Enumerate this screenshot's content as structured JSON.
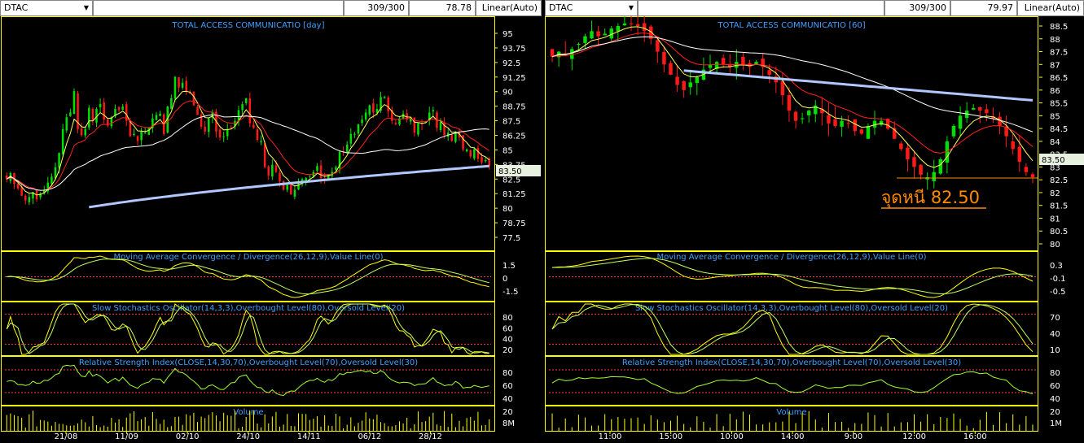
{
  "panels": [
    {
      "id": "left",
      "symbol": "DTAC",
      "count": "309/300",
      "last_price": "78.78",
      "scale": "Linear(Auto)",
      "price_title": "TOTAL ACCESS COMMUNICATIO [day]",
      "price_ticks": [
        "95",
        "93.75",
        "92.5",
        "91.25",
        "90",
        "88.75",
        "87.5",
        "86.25",
        "85",
        "83.75",
        "82.5",
        "81.25",
        "80",
        "78.75",
        "77.5"
      ],
      "price_tag": "83.50",
      "macd_title": "Moving Average Convergence / Divergence(26,12,9),Value Line(0)",
      "macd_ticks": [
        "1.5",
        "0",
        "-1.5"
      ],
      "stoch_title": "Slow Stochastics Oscillator(14,3,3),Overbought Level(80),Oversold Level(20)",
      "stoch_ticks": [
        "80",
        "60",
        "40",
        "20"
      ],
      "rsi_title": "Relative Strength Index(CLOSE,14,30,70),Overbought Level(70),Oversold Level(30)",
      "rsi_ticks": [
        "80",
        "60",
        "40",
        "20"
      ],
      "vol_title": "Volume",
      "vol_tick": "8M",
      "x_ticks": [
        "21/08",
        "11/09",
        "02/10",
        "24/10",
        "14/11",
        "06/12",
        "28/12"
      ]
    },
    {
      "id": "right",
      "symbol": "DTAC",
      "count": "309/300",
      "last_price": "79.97",
      "scale": "Linear(Auto)",
      "price_title": "TOTAL ACCESS COMMUNICATIO [60]",
      "price_ticks": [
        "88.5",
        "88",
        "87.5",
        "87",
        "86.5",
        "86",
        "85.5",
        "85",
        "84.5",
        "84",
        "83.5",
        "83",
        "82.5",
        "82",
        "81.5",
        "81",
        "80.5",
        "80"
      ],
      "price_tag": "83.50",
      "annotation": "จุดหนี 82.50",
      "macd_title": "Moving Average Convergence / Divergence(26,12,9),Value Line(0)",
      "macd_ticks": [
        "0.3",
        "-0.1",
        "-0.5"
      ],
      "stoch_title": "Slow Stochastics Oscillator(14,3,3),Overbought Level(80),Oversold Level(20)",
      "stoch_ticks": [
        "70",
        "40",
        "10"
      ],
      "rsi_title": "Relative Strength Index(CLOSE,14,30,70),Overbought Level(70),Oversold Level(30)",
      "rsi_ticks": [
        "80",
        "60",
        "40",
        "20"
      ],
      "vol_title": "Volume",
      "vol_tick": "1M",
      "x_ticks": [
        "11:00",
        "15:00",
        "10:00",
        "14:00",
        "9:00",
        "12:00",
        "16:00"
      ]
    }
  ],
  "chart_data": [
    {
      "type": "candlestick",
      "title": "TOTAL ACCESS COMMUNICATIO [day]",
      "x_ticks": [
        "21/08",
        "11/09",
        "02/10",
        "24/10",
        "14/11",
        "06/12",
        "28/12"
      ],
      "ylim": [
        77.5,
        95
      ],
      "close_series": [
        82.4,
        82.9,
        82.0,
        81.6,
        81.0,
        80.6,
        80.9,
        81.3,
        80.7,
        81.2,
        81.5,
        82.1,
        82.6,
        83.4,
        84.6,
        86.6,
        87.6,
        88.0,
        89.8,
        86.6,
        86.1,
        86.6,
        88.4,
        87.3,
        88.3,
        88.7,
        87.4,
        86.9,
        87.6,
        88.3,
        88.2,
        88.5,
        87.3,
        86.0,
        86.2,
        85.6,
        86.4,
        86.3,
        86.7,
        87.5,
        87.8,
        87.9,
        86.2,
        88.5,
        89.2,
        91.0,
        90.1,
        90.5,
        89.8,
        89.6,
        88.6,
        87.8,
        86.8,
        86.4,
        87.5,
        88.0,
        86.4,
        85.9,
        86.0,
        86.6,
        86.7,
        87.3,
        88.2,
        88.7,
        89.2,
        87.1,
        86.7,
        85.7,
        85.6,
        83.4,
        82.7,
        83.6,
        83.0,
        82.2,
        81.5,
        81.9,
        81.1,
        81.5,
        82.0,
        82.4,
        82.5,
        82.7,
        83.0,
        83.5,
        82.5,
        82.4,
        82.8,
        83.0,
        83.4,
        84.7,
        84.7,
        85.3,
        86.2,
        86.2,
        87.0,
        87.4,
        88.0,
        88.6,
        88.0,
        88.3,
        89.3,
        89.3,
        88.1,
        87.3,
        87.0,
        87.5,
        87.9,
        87.4,
        87.6,
        86.3,
        87.1,
        87.0,
        87.2,
        88.0,
        88.2,
        86.7,
        87.2,
        86.1,
        86.3,
        85.6,
        86.4,
        85.9,
        84.9,
        84.9,
        84.3,
        84.9,
        84.1,
        83.8,
        84.0,
        83.5
      ],
      "moving_averages": [
        "close-ma",
        "short-ma",
        "medium-ma",
        "long-ma"
      ],
      "indicators": [
        "MACD(26,12,9)",
        "Slow Stochastics(14,3,3)",
        "RSI(14,30,70)",
        "Volume"
      ],
      "macd_ylim": [
        -1.5,
        1.5
      ],
      "stoch_levels": [
        80,
        20
      ],
      "rsi_levels": [
        70,
        30
      ]
    },
    {
      "type": "candlestick",
      "title": "TOTAL ACCESS COMMUNICATIO [60]",
      "x_ticks": [
        "11:00",
        "15:00",
        "10:00",
        "14:00",
        "9:00",
        "12:00",
        "16:00"
      ],
      "ylim": [
        80,
        88.5
      ],
      "close_series": [
        87.3,
        87.5,
        87.4,
        87.6,
        87.8,
        88.1,
        88.3,
        88.1,
        88.2,
        88.4,
        88.5,
        88.6,
        88.6,
        88.5,
        88.3,
        88.0,
        87.5,
        87.0,
        86.6,
        86.2,
        86.0,
        86.3,
        86.5,
        86.8,
        87.0,
        87.1,
        87.0,
        86.9,
        87.1,
        87.0,
        86.9,
        87.1,
        86.9,
        86.6,
        86.3,
        85.8,
        85.2,
        84.8,
        84.9,
        85.2,
        85.4,
        85.1,
        84.7,
        84.6,
        84.8,
        84.7,
        84.4,
        84.3,
        84.6,
        84.8,
        84.8,
        84.5,
        84.1,
        83.7,
        83.3,
        83.0,
        82.7,
        82.6,
        82.8,
        83.3,
        84.0,
        84.6,
        85.0,
        85.2,
        85.3,
        85.2,
        85.1,
        84.9,
        84.6,
        84.2,
        83.7,
        83.2,
        82.8,
        82.6
      ],
      "moving_averages": [
        "close-ma",
        "short-ma",
        "medium-ma",
        "long-ma"
      ],
      "indicators": [
        "MACD(26,12,9)",
        "Slow Stochastics(14,3,3)",
        "RSI(14,30,70)",
        "Volume"
      ],
      "macd_ylim": [
        -0.5,
        0.3
      ],
      "stoch_levels": [
        80,
        20
      ],
      "rsi_levels": [
        70,
        30
      ]
    }
  ],
  "colors": {
    "up": "#00e000",
    "down": "#ff1a1a",
    "frame": "#ffff00",
    "title": "#40a0ff",
    "ma_long": "#b0c8ff",
    "ma_mid": "#ffffff",
    "ma_short": "#ff2020",
    "ma_fast": "#ffff60",
    "annotation": "#ff8a00"
  }
}
